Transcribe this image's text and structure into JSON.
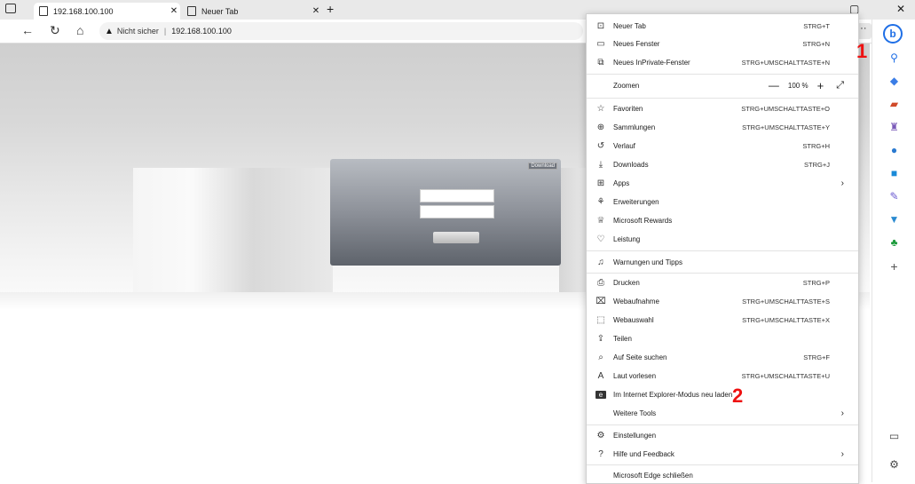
{
  "tabs": [
    {
      "title": "192.168.100.100"
    },
    {
      "title": "Neuer Tab"
    }
  ],
  "address": {
    "security_label": "Nicht sicher",
    "separator": "|",
    "url": "192.168.100.100"
  },
  "login": {
    "download_label": "Download"
  },
  "menu": {
    "items": [
      {
        "label": "Neuer Tab",
        "shortcut": "STRG+T",
        "icon": "new-tab-icon"
      },
      {
        "label": "Neues Fenster",
        "shortcut": "STRG+N",
        "icon": "new-window-icon"
      },
      {
        "label": "Neues InPrivate-Fenster",
        "shortcut": "STRG+UMSCHALTTASTE+N",
        "icon": "inprivate-icon"
      },
      {
        "label": "Zoomen",
        "zoom": "100 %"
      },
      {
        "label": "Favoriten",
        "shortcut": "STRG+UMSCHALTTASTE+O",
        "icon": "favorites-icon"
      },
      {
        "label": "Sammlungen",
        "shortcut": "STRG+UMSCHALTTASTE+Y",
        "icon": "collections-icon"
      },
      {
        "label": "Verlauf",
        "shortcut": "STRG+H",
        "icon": "history-icon"
      },
      {
        "label": "Downloads",
        "shortcut": "STRG+J",
        "icon": "download-icon"
      },
      {
        "label": "Apps",
        "icon": "apps-icon"
      },
      {
        "label": "Erweiterungen",
        "icon": "extensions-icon"
      },
      {
        "label": "Microsoft Rewards",
        "icon": "rewards-icon"
      },
      {
        "label": "Leistung",
        "icon": "performance-icon"
      },
      {
        "label": "Warnungen und Tipps",
        "icon": "bell-icon"
      },
      {
        "label": "Drucken",
        "shortcut": "STRG+P",
        "icon": "print-icon"
      },
      {
        "label": "Webaufnahme",
        "shortcut": "STRG+UMSCHALTTASTE+S",
        "icon": "web-capture-icon"
      },
      {
        "label": "Webauswahl",
        "shortcut": "STRG+UMSCHALTTASTE+X",
        "icon": "web-select-icon"
      },
      {
        "label": "Teilen",
        "icon": "share-icon"
      },
      {
        "label": "Auf Seite suchen",
        "shortcut": "STRG+F",
        "icon": "find-icon"
      },
      {
        "label": "Laut vorlesen",
        "shortcut": "STRG+UMSCHALTTASTE+U",
        "icon": "read-aloud-icon"
      },
      {
        "label": "Im Internet Explorer-Modus neu laden",
        "icon": "ie-mode-icon"
      },
      {
        "label": "Weitere Tools"
      },
      {
        "label": "Einstellungen",
        "icon": "settings-icon"
      },
      {
        "label": "Hilfe und Feedback",
        "icon": "help-icon"
      },
      {
        "label": "Microsoft Edge schließen"
      }
    ]
  },
  "markers": {
    "one": "1",
    "two": "2"
  },
  "colors": {
    "marker": "#e11111",
    "accent": "#1f6fe6"
  }
}
